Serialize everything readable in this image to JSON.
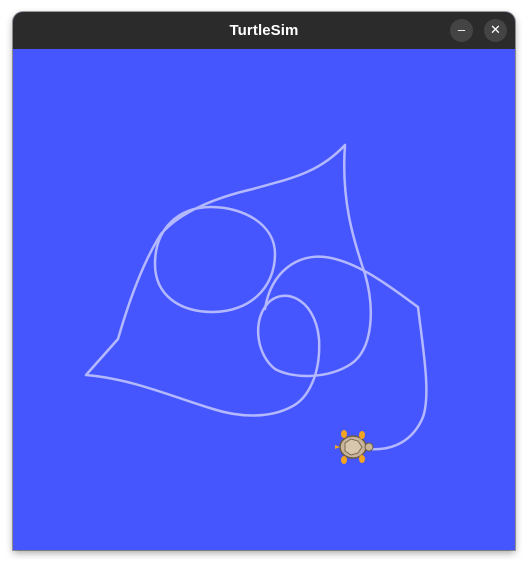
{
  "window": {
    "title": "TurtleSim",
    "minimize_glyph": "–",
    "close_glyph": "✕"
  },
  "canvas": {
    "background_color": "#4656ff",
    "pen_color": "#b3b8ff"
  },
  "icons": [
    "minimize-icon",
    "close-icon",
    "turtle-icon"
  ]
}
